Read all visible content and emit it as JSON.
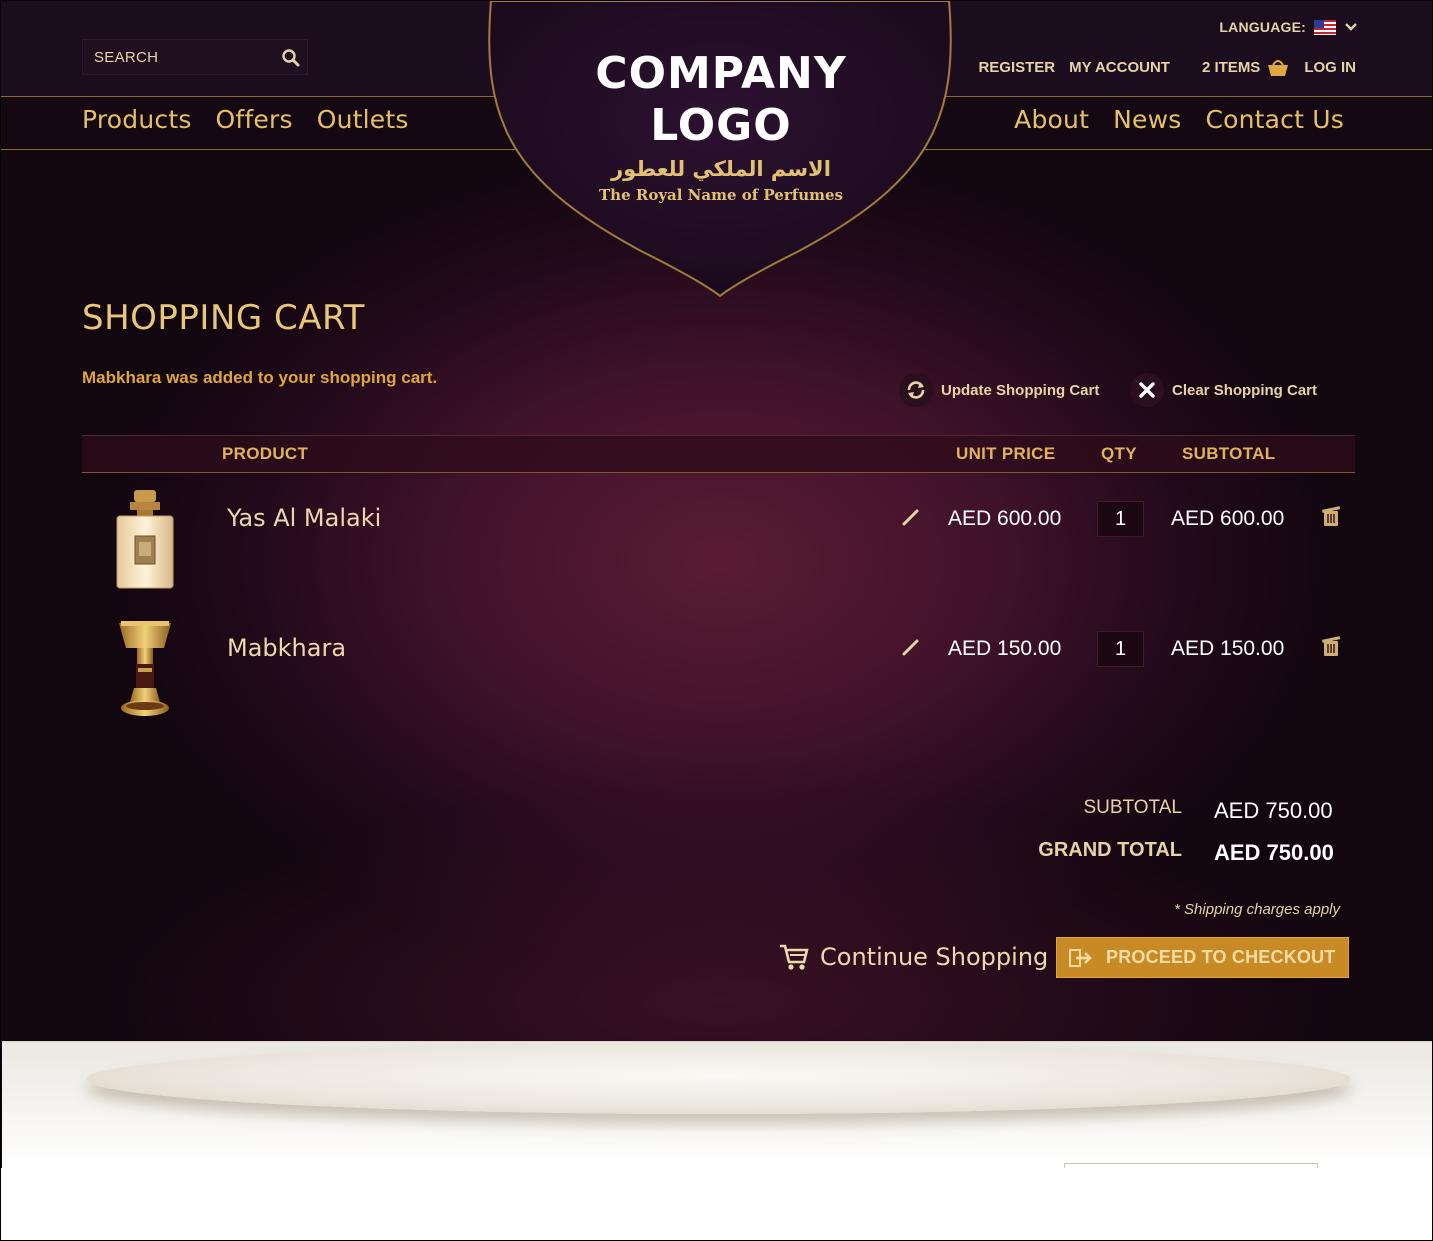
{
  "header": {
    "search": {
      "placeholder": "SEARCH"
    },
    "nav_left": [
      "Products",
      "Offers",
      "Outlets"
    ],
    "nav_right": [
      "About",
      "News",
      "Contact Us"
    ],
    "language": {
      "label": "LANGUAGE:",
      "selected": "flag-us-icon"
    },
    "account": {
      "register": "REGISTER",
      "my_account": "MY ACCOUNT",
      "cart_items": "2 ITEMS",
      "log_in": "LOG IN"
    },
    "logo": {
      "line1": "COMPANY",
      "line2": "LOGO",
      "arabic": "الاسم الملكي للعطور",
      "english": "The Royal Name of Perfumes"
    }
  },
  "cart": {
    "title": "SHOPPING CART",
    "notice": "Mabkhara was added to your shopping cart.",
    "update_label": "Update Shopping Cart",
    "clear_label": "Clear Shopping Cart",
    "columns": {
      "product": "PRODUCT",
      "unit_price": "UNIT PRICE",
      "qty": "QTY",
      "subtotal": "SUBTOTAL"
    },
    "items": [
      {
        "name": "Yas Al Malaki",
        "unit_price": "AED 600.00",
        "qty": "1",
        "subtotal": "AED 600.00",
        "image": "perfume-bottle-icon"
      },
      {
        "name": "Mabkhara",
        "unit_price": "AED 150.00",
        "qty": "1",
        "subtotal": "AED 150.00",
        "image": "incense-burner-icon"
      }
    ],
    "totals": {
      "subtotal_label": "SUBTOTAL",
      "subtotal_value": "AED 750.00",
      "grand_total_label": "GRAND TOTAL",
      "grand_total_value": "AED 750.00"
    },
    "shipping_note": "* Shipping charges apply",
    "continue_label": "Continue Shopping",
    "checkout_label": "PROCEED TO CHECKOUT"
  },
  "colors": {
    "accent_gold": "#e6c066",
    "checkout_button": "#c88a24",
    "background_plum": "#40122a",
    "notice": "#e1a63a"
  }
}
